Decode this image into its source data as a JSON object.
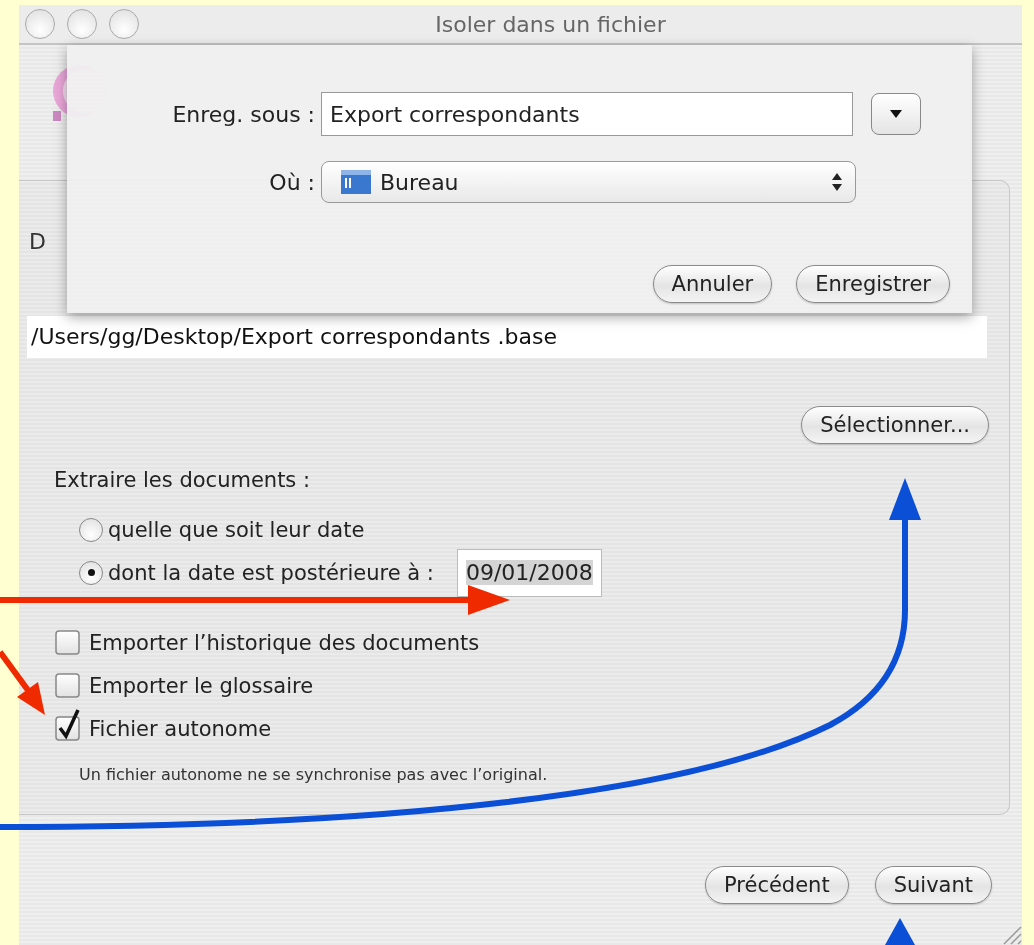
{
  "window": {
    "title": "Isoler dans un fichier"
  },
  "save_sheet": {
    "save_as_label": "Enreg. sous :",
    "filename": "Export correspondants",
    "where_label": "Où :",
    "location": "Bureau",
    "buttons": [
      "Annuler",
      "Enregistrer"
    ]
  },
  "file_section": {
    "label": "D",
    "path": "/Users/gg/Desktop/Export correspondants .base",
    "select_button": "Sélectionner..."
  },
  "extract": {
    "label": "Extraire les documents :",
    "options": [
      {
        "label": "quelle que soit leur date",
        "selected": false
      },
      {
        "label": "dont la date est postérieure à :",
        "selected": true,
        "date": "09/01/2008"
      }
    ]
  },
  "checkboxes": [
    {
      "label": "Emporter l’historique des documents",
      "checked": false
    },
    {
      "label": "Emporter le glossaire",
      "checked": false
    },
    {
      "label": "Fichier autonome",
      "checked": true
    }
  ],
  "note": "Un fichier autonome ne se synchronise pas avec l’original.",
  "nav_buttons": [
    "Précédent",
    "Suivant"
  ]
}
